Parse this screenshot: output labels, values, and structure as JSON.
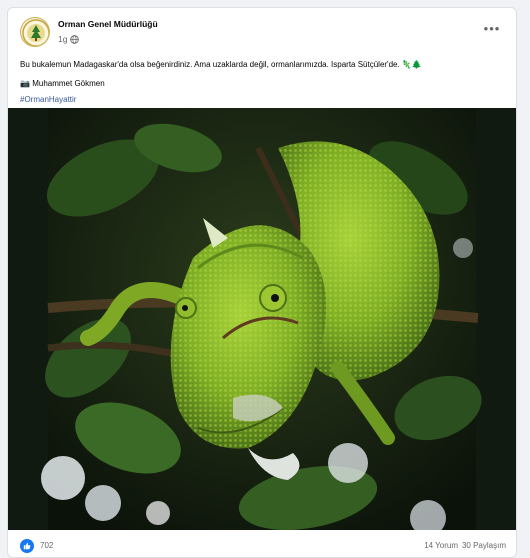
{
  "post": {
    "page_name": "Orman Genel Müdürlüğü",
    "time": "1g",
    "privacy_icon": "globe-icon",
    "more_label": "•••",
    "text_line1": "Bu bukalemun Madagaskar'da olsa beğenirdiniz. Ama uzaklarda değil, ormanlarımızda. Isparta Sütçüler'de. 🦎🌲",
    "camera_emoji": "📷",
    "photographer": "Muhammet Gökmen",
    "hashtag": "#OrmanHayattir"
  },
  "photo": {
    "subject": "green chameleon on branch",
    "colors": {
      "chameleon": "#8bbf2a",
      "leaves": "#2f5a1f",
      "background": "#0e150c"
    }
  },
  "reactions": {
    "icon": "like-icon",
    "count": "702",
    "comments": "14 Yorum",
    "shares": "30 Paylaşım"
  },
  "colors": {
    "link": "#385898",
    "muted": "#65676b",
    "like_blue": "#1877f2"
  }
}
